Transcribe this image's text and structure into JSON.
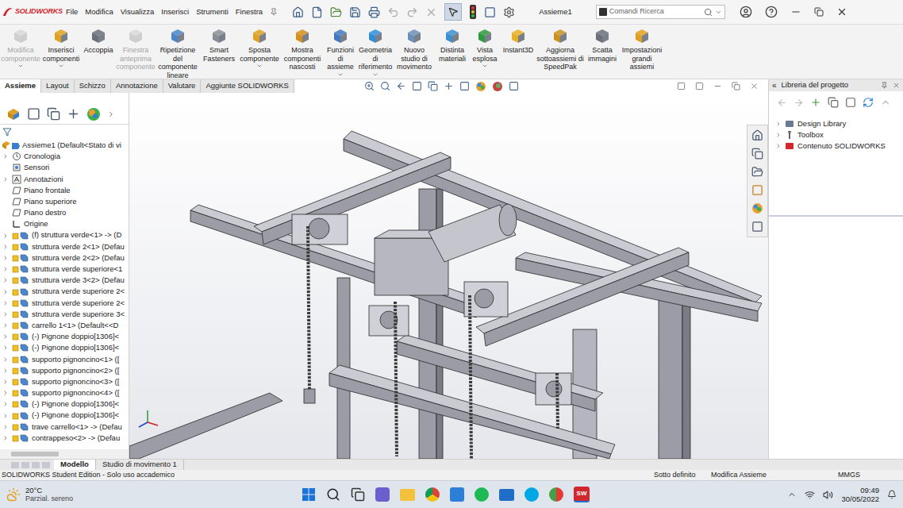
{
  "app": {
    "logo": "SOLIDWORKS",
    "document": "Assieme1"
  },
  "menu": [
    "File",
    "Modifica",
    "Visualizza",
    "Inserisci",
    "Strumenti",
    "Finestra"
  ],
  "search": {
    "placeholder": "Comandi Ricerca"
  },
  "ribbon": [
    {
      "label": "Modifica componente",
      "disabled": true,
      "dropdown": true
    },
    {
      "label": "Inserisci componenti",
      "disabled": false,
      "dropdown": true
    },
    {
      "label": "Accoppia",
      "disabled": false,
      "dropdown": false
    },
    {
      "label": "Finestra anteprima componente",
      "disabled": true,
      "dropdown": false
    },
    {
      "label": "Ripetizione del componente lineare",
      "disabled": false,
      "dropdown": true
    },
    {
      "label": "Smart Fasteners",
      "disabled": false,
      "dropdown": false
    },
    {
      "label": "Sposta componente",
      "disabled": false,
      "dropdown": true
    },
    {
      "label": "Mostra componenti nascosti",
      "disabled": false,
      "dropdown": false
    },
    {
      "label": "Funzioni di assieme",
      "disabled": false,
      "dropdown": true
    },
    {
      "label": "Geometria di riferimento",
      "disabled": false,
      "dropdown": true
    },
    {
      "label": "Nuovo studio di movimento",
      "disabled": false,
      "dropdown": false
    },
    {
      "label": "Distinta materiali",
      "disabled": false,
      "dropdown": false
    },
    {
      "label": "Vista esplosa",
      "disabled": false,
      "dropdown": true
    },
    {
      "label": "Instant3D",
      "disabled": false,
      "dropdown": false
    },
    {
      "label": "Aggiorna sottoassiemi di SpeedPak",
      "disabled": false,
      "dropdown": false
    },
    {
      "label": "Scatta immagini",
      "disabled": false,
      "dropdown": false
    },
    {
      "label": "Impostazioni grandi assiemi",
      "disabled": false,
      "dropdown": false
    }
  ],
  "tabs": [
    {
      "label": "Assieme",
      "selected": true
    },
    {
      "label": "Layout",
      "selected": false
    },
    {
      "label": "Schizzo",
      "selected": false
    },
    {
      "label": "Annotazione",
      "selected": false
    },
    {
      "label": "Valutare",
      "selected": false
    },
    {
      "label": "Aggiunte SOLIDWORKS",
      "selected": false
    }
  ],
  "tree": {
    "root": "Assieme1  (Default<Stato di vi",
    "items": [
      {
        "label": "Cronologia",
        "kind": "history",
        "expandable": true
      },
      {
        "label": "Sensori",
        "kind": "sensor",
        "expandable": false
      },
      {
        "label": "Annotazioni",
        "kind": "annotation",
        "expandable": true
      },
      {
        "label": "Piano frontale",
        "kind": "plane",
        "expandable": false
      },
      {
        "label": "Piano superiore",
        "kind": "plane",
        "expandable": false
      },
      {
        "label": "Piano destro",
        "kind": "plane",
        "expandable": false
      },
      {
        "label": "Origine",
        "kind": "origin",
        "expandable": false
      },
      {
        "label": "(f) struttura verde<1> -> (D",
        "kind": "part",
        "expandable": true
      },
      {
        "label": "struttura verde 2<1> (Defau",
        "kind": "part",
        "expandable": true
      },
      {
        "label": "struttura verde 2<2> (Defau",
        "kind": "part",
        "expandable": true
      },
      {
        "label": "struttura verde superiore<1",
        "kind": "part",
        "expandable": true
      },
      {
        "label": "struttura verde 3<2> (Defau",
        "kind": "part",
        "expandable": true
      },
      {
        "label": "struttura verde superiore 2<",
        "kind": "part",
        "expandable": true
      },
      {
        "label": "struttura verde superiore 2<",
        "kind": "part",
        "expandable": true
      },
      {
        "label": "struttura verde superiore 3<",
        "kind": "part",
        "expandable": true
      },
      {
        "label": "carrello 1<1> (Default<<D",
        "kind": "part",
        "expandable": true
      },
      {
        "label": "(-) Pignone doppio[1306]<",
        "kind": "part",
        "expandable": true
      },
      {
        "label": "(-) Pignone doppio[1306]<",
        "kind": "part",
        "expandable": true
      },
      {
        "label": "supporto pignoncino<1> ([",
        "kind": "part",
        "expandable": true
      },
      {
        "label": "supporto pignoncino<2> ([",
        "kind": "part",
        "expandable": true
      },
      {
        "label": "supporto pignoncino<3> ([",
        "kind": "part",
        "expandable": true
      },
      {
        "label": "supporto pignoncino<4> ([",
        "kind": "part",
        "expandable": true
      },
      {
        "label": "(-) Pignone doppio[1306]<",
        "kind": "part",
        "expandable": true
      },
      {
        "label": "(-) Pignone doppio[1306]<",
        "kind": "part",
        "expandable": true
      },
      {
        "label": "trave carrello<1> -> (Defau",
        "kind": "part",
        "expandable": true
      },
      {
        "label": "contrappeso<2> -> (Defau",
        "kind": "part",
        "expandable": true
      }
    ]
  },
  "library": {
    "collapse": "«",
    "title": "Libreria del progetto",
    "items": [
      {
        "label": "Design Library",
        "kind": "library"
      },
      {
        "label": "Toolbox",
        "kind": "toolbox"
      },
      {
        "label": "Contenuto SOLIDWORKS",
        "kind": "content"
      }
    ]
  },
  "bottom_tabs": [
    {
      "label": "Modello",
      "selected": true
    },
    {
      "label": "Studio di movimento 1",
      "selected": false
    }
  ],
  "status_bar": {
    "edition": "SOLIDWORKS Student Edition - Solo uso accademico",
    "state": "Sotto definito",
    "mode": "Modifica Assieme",
    "units": "MMGS"
  },
  "taskbar": {
    "temperature": "20°C",
    "weather": "Parzial. sereno",
    "app_badge": "SW",
    "time": "09:49",
    "date": "30/05/2022"
  }
}
